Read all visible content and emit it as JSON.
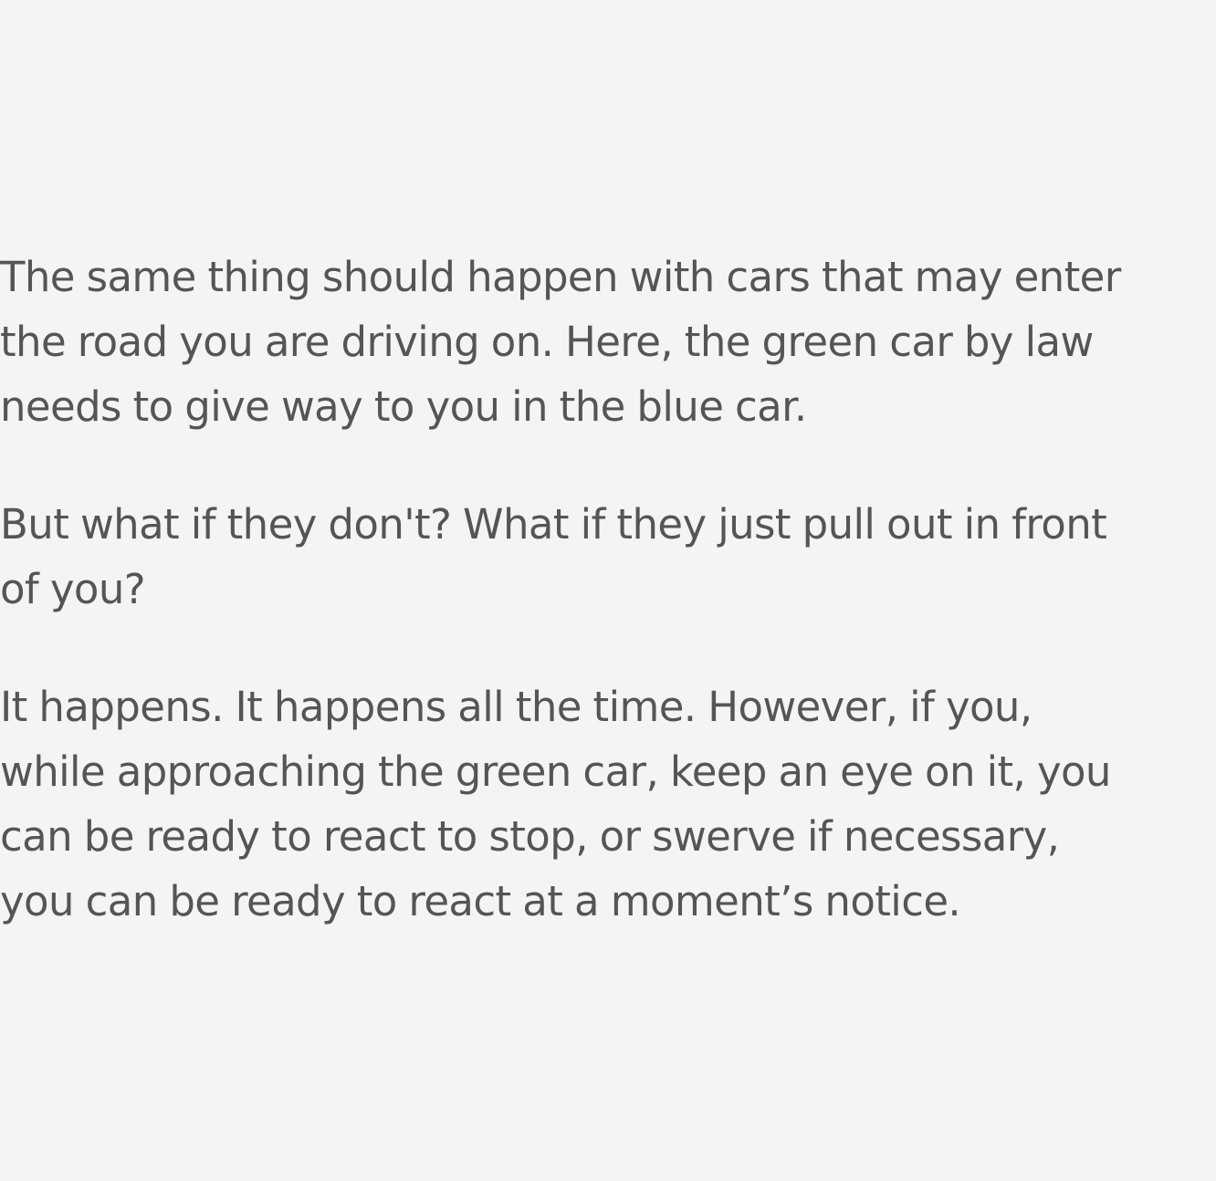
{
  "article": {
    "paragraphs": [
      {
        "lines": [
          "The same thing should happen with cars that may enter",
          "the road you are driving on. Here, the green car by law",
          "needs to give way to you in the blue car."
        ]
      },
      {
        "lines": [
          "But what if they don't? What if they just pull out in front",
          "of you?"
        ]
      },
      {
        "lines": [
          "It happens. It happens all the time. However, if you,",
          "while approaching the green car, keep an eye on it, you",
          "can be ready to react to stop, or swerve if necessary,",
          "you can be ready to react at a moment’s notice."
        ]
      }
    ],
    "text_color": "#555555",
    "background_color": "#f4f4f4"
  }
}
